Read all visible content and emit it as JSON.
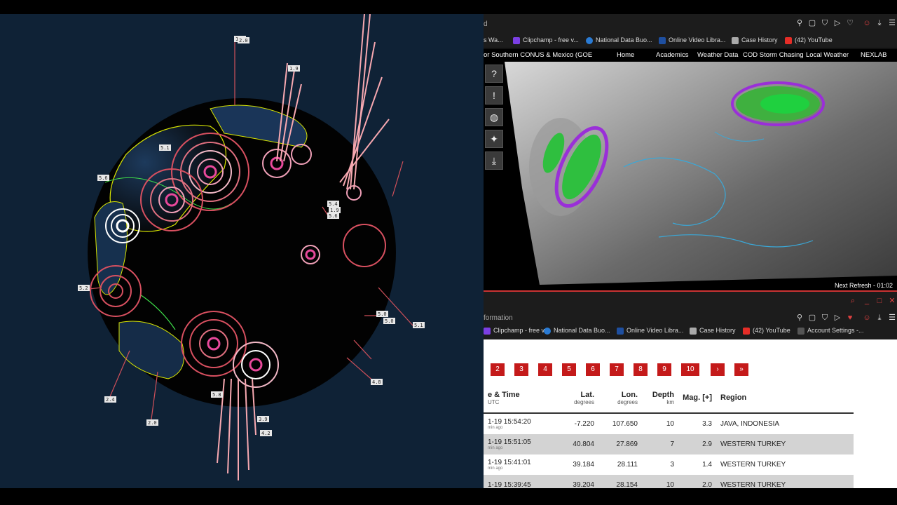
{
  "globe": {
    "labels": [
      "1.9",
      "5.0",
      "5.0",
      "5.1",
      "5.2",
      "5.8",
      "5.1",
      "5.4",
      "5.6",
      "4.8",
      "2.4",
      "2.0",
      "2.0",
      "1.9",
      "1.9",
      "3.9",
      "4.2",
      "5.6"
    ]
  },
  "map_window": {
    "tab_title_fragment": "d",
    "bookmarks": [
      {
        "label": "s Wa...",
        "color": "#888888"
      },
      {
        "label": "Clipchamp - free v...",
        "color": "#7b3fe4"
      },
      {
        "label": "National Data Buo...",
        "color": "#2a7bd4"
      },
      {
        "label": "Online Video Libra...",
        "color": "#1e4fa0"
      },
      {
        "label": "Case History",
        "color": "#aaaaaa"
      },
      {
        "label": "(42) YouTube",
        "color": "#e52d27"
      }
    ],
    "site_title": "or Southern CONUS & Mexico (GOE",
    "nav": [
      "Home",
      "Academics",
      "Weather Data",
      "COD Storm Chasing",
      "Local Weather",
      "NEXLAB"
    ],
    "tools": [
      "?",
      "!",
      "globe",
      "satellite",
      "download"
    ],
    "next_refresh": "Next Refresh - 01:02"
  },
  "eq_window": {
    "tab_title_fragment": "formation",
    "bookmarks": [
      {
        "label": "Clipchamp - free v...",
        "color": "#7b3fe4"
      },
      {
        "label": "National Data Buo...",
        "color": "#2a7bd4"
      },
      {
        "label": "Online Video Libra...",
        "color": "#1e4fa0"
      },
      {
        "label": "Case History",
        "color": "#aaaaaa"
      },
      {
        "label": "(42) YouTube",
        "color": "#e52d27"
      },
      {
        "label": "Account Settings -...",
        "color": "#555555"
      }
    ],
    "pages": [
      "2",
      "3",
      "4",
      "5",
      "6",
      "7",
      "8",
      "9",
      "10",
      "›",
      "»"
    ],
    "headers": {
      "time": "e & Time",
      "time_sub": "UTC",
      "lat": "Lat.",
      "lat_sub": "degrees",
      "lon": "Lon.",
      "lon_sub": "degrees",
      "depth": "Depth",
      "depth_sub": "km",
      "mag": "Mag. [+]",
      "region": "Region"
    },
    "rows": [
      {
        "time": "1-19 15:54:20",
        "ago": "min ago",
        "lat": "-7.220",
        "lon": "107.650",
        "depth": "10",
        "mag": "3.3",
        "region": "JAVA, INDONESIA"
      },
      {
        "time": "1-19 15:51:05",
        "ago": "min ago",
        "lat": "40.804",
        "lon": "27.869",
        "depth": "7",
        "mag": "2.9",
        "region": "WESTERN TURKEY"
      },
      {
        "time": "1-19 15:41:01",
        "ago": "min ago",
        "lat": "39.184",
        "lon": "28.111",
        "depth": "3",
        "mag": "1.4",
        "region": "WESTERN TURKEY"
      },
      {
        "time": "1-19 15:39:45",
        "ago": "",
        "lat": "39.204",
        "lon": "28.154",
        "depth": "10",
        "mag": "2.0",
        "region": "WESTERN TURKEY"
      }
    ]
  }
}
